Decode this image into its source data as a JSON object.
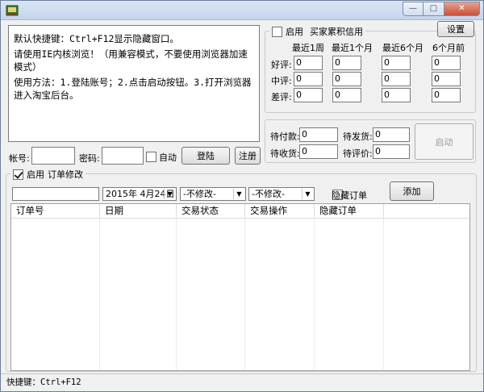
{
  "window": {
    "controls": {
      "minimize": "—",
      "maximize": "□",
      "close": "✕"
    }
  },
  "info": {
    "lines": [
      "默认快捷键：Ctrl+F12显示隐藏窗口。",
      "请使用IE内核浏览！（用兼容模式，不要使用浏览器加速模式）",
      "使用方法：1.登陆账号；2.点击启动按钮。3.打开浏览器进入淘宝后台。"
    ]
  },
  "credit": {
    "enable_label": "启用",
    "group_title": "买家累积信用",
    "settings_button": "设置",
    "columns": [
      "最近1周",
      "最近1个月",
      "最近6个月",
      "6个月前"
    ],
    "rows": [
      {
        "label": "好评:",
        "values": [
          "0",
          "0",
          "0",
          "0"
        ]
      },
      {
        "label": "中评:",
        "values": [
          "0",
          "0",
          "0",
          "0"
        ]
      },
      {
        "label": "差评:",
        "values": [
          "0",
          "0",
          "0",
          "0"
        ]
      }
    ]
  },
  "pending": {
    "to_pay_label": "待付款:",
    "to_pay_value": "0",
    "to_ship_label": "待发货:",
    "to_ship_value": "0",
    "to_receive_label": "待收货:",
    "to_receive_value": "0",
    "to_review_label": "待评价:",
    "to_review_value": "0",
    "start_button": "启动"
  },
  "login": {
    "account_label": "帐号:",
    "account_value": "",
    "password_label": "密码:",
    "password_value": "",
    "auto_label": "自动",
    "login_button": "登陆",
    "register_button": "注册"
  },
  "orders": {
    "enable_label": "启用",
    "group_title": "订单修改",
    "filter_value": "",
    "date_value": "2015年 4月24日",
    "status_select": "-不修改-",
    "operation_select": "-不修改-",
    "hide_label": "隐藏订单",
    "add_button": "添加",
    "columns": [
      "订单号",
      "日期",
      "交易状态",
      "交易操作",
      "隐藏订单"
    ]
  },
  "status": {
    "text": "快捷键：Ctrl+F12"
  }
}
